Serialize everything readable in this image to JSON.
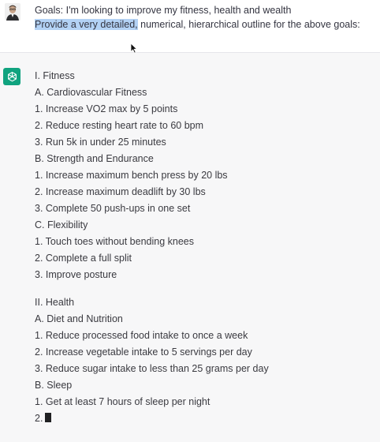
{
  "user_message": {
    "line1": "Goals: I'm looking to improve my fitness, health and wealth",
    "line2_highlighted": "Provide a very detailed,",
    "line2_rest": " numerical, hierarchical outline for the above goals:"
  },
  "assistant": {
    "avatar_icon": "openai-logo-icon",
    "accent_color": "#10a37f",
    "lines": [
      "I. Fitness",
      "A. Cardiovascular Fitness",
      "1. Increase VO2 max by 5 points",
      "2. Reduce resting heart rate to 60 bpm",
      "3. Run 5k in under 25 minutes",
      "B. Strength and Endurance",
      "1. Increase maximum bench press by 20 lbs",
      "2. Increase maximum deadlift by 30 lbs",
      "3. Complete 50 push-ups in one set",
      "C. Flexibility",
      "1. Touch toes without bending knees",
      "2. Complete a full split",
      "3. Improve posture",
      "II. Health",
      "A. Diet and Nutrition",
      "1. Reduce processed food intake to once a week",
      "2. Increase vegetable intake to 5 servings per day",
      "3. Reduce sugar intake to less than 25 grams per day",
      "B. Sleep",
      "1. Get at least 7 hours of sleep per night",
      "2."
    ]
  }
}
